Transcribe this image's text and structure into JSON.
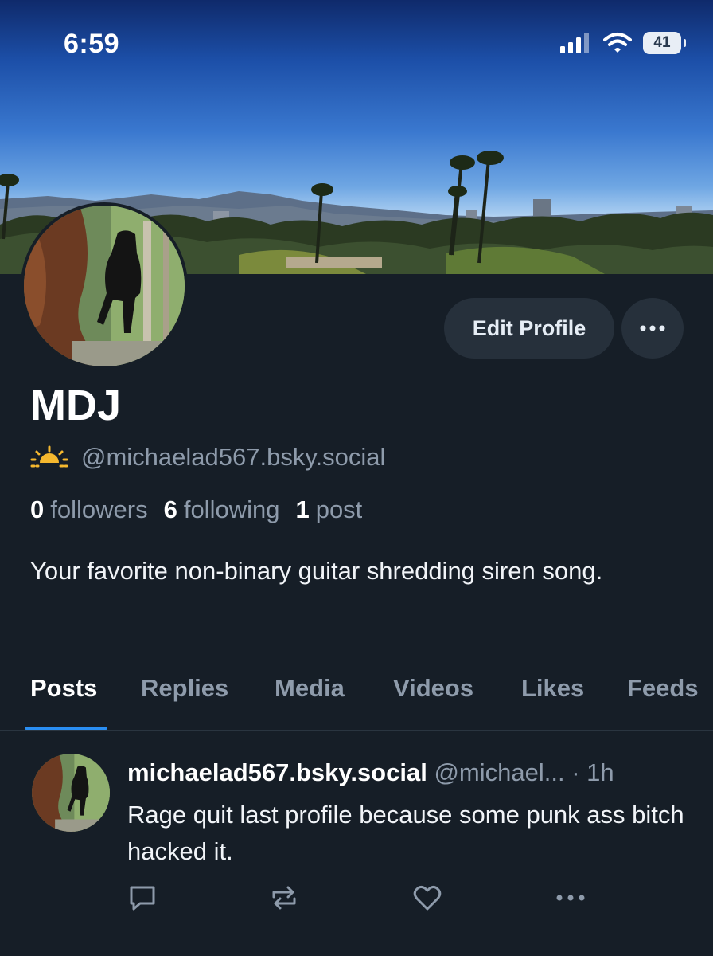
{
  "status_bar": {
    "time": "6:59",
    "battery": "41",
    "icons": [
      "cellular-signal-icon",
      "wifi-icon",
      "battery-icon"
    ]
  },
  "profile": {
    "display_name": "MDJ",
    "handle": "@michaelad567.bsky.social",
    "handle_emoji": "sunrise-icon",
    "edit_label": "Edit Profile",
    "stats": {
      "followers_count": "0",
      "followers_label": "followers",
      "following_count": "6",
      "following_label": "following",
      "posts_count": "1",
      "posts_label": "post"
    },
    "bio": "Your favorite non-binary guitar shredding siren song."
  },
  "tabs": [
    "Posts",
    "Replies",
    "Media",
    "Videos",
    "Likes",
    "Feeds"
  ],
  "active_tab": "Posts",
  "posts": [
    {
      "author": "michaelad567.bsky.social",
      "handle": "@michael...",
      "time": "· 1h",
      "text": "Rage quit last profile because some punk ass bitch hacked it."
    }
  ],
  "colors": {
    "background": "#161e27",
    "accent": "#2a8ef2",
    "muted_text": "#8e9bab",
    "button_bg": "#26303b"
  }
}
